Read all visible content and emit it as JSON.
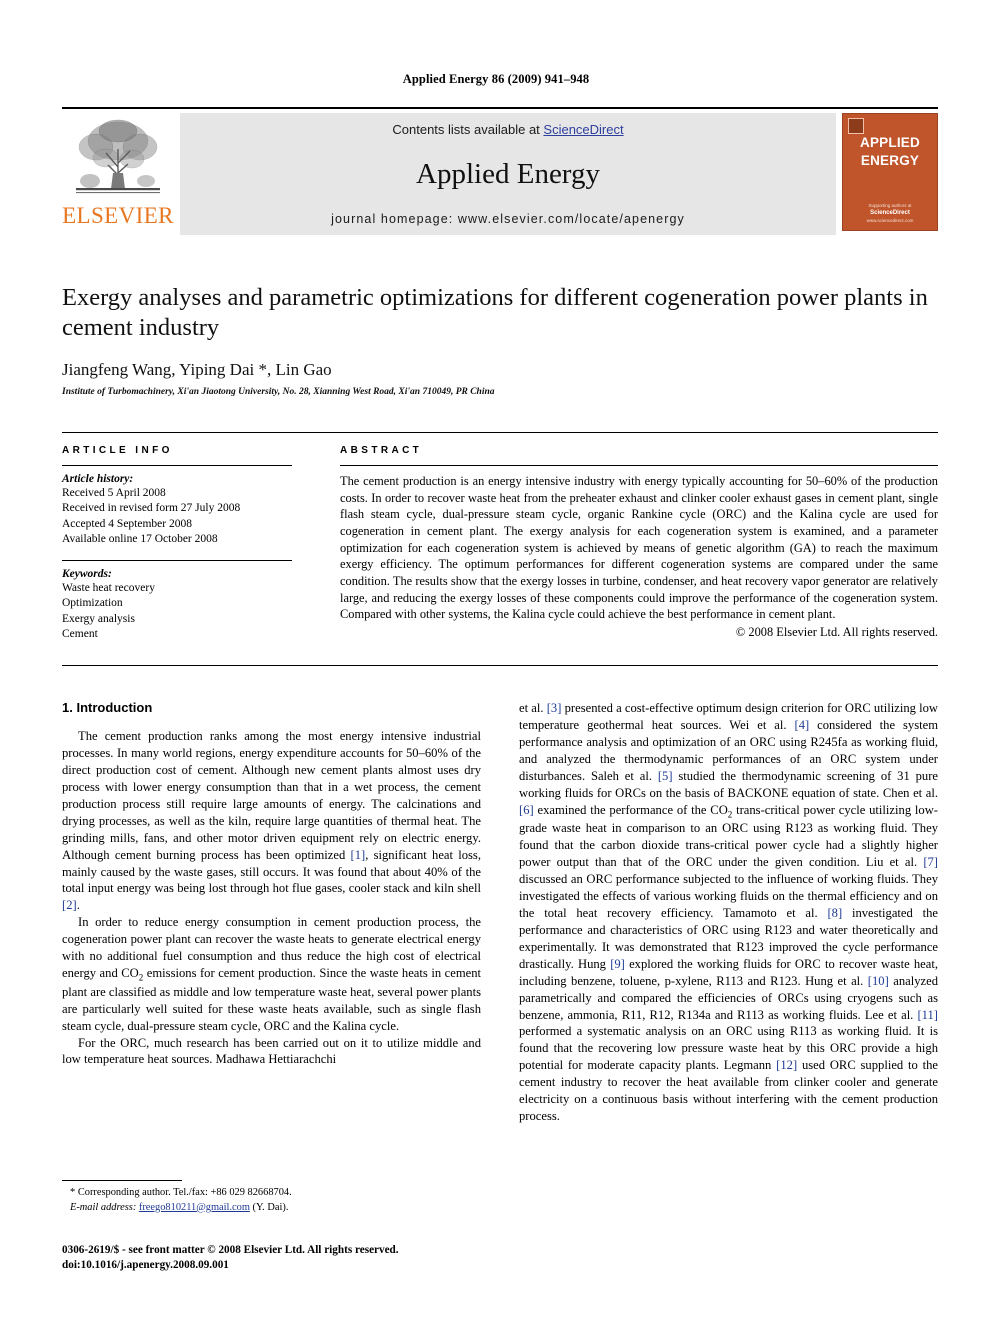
{
  "running_head": "Applied Energy 86 (2009) 941–948",
  "banner": {
    "publisher_name": "ELSEVIER",
    "contents_prefix": "Contents lists available at ",
    "contents_link": "ScienceDirect",
    "journal_name": "Applied Energy",
    "homepage": "journal homepage: www.elsevier.com/locate/apenergy",
    "cover_title_line1": "APPLIED",
    "cover_title_line2": "ENERGY",
    "cover_foot_line1": "Supporting authors at",
    "cover_foot_line2": "ScienceDirect",
    "cover_foot_line3": "www.sciencedirect.com",
    "cover_color": "#C0542A",
    "link_color": "#2C3E9E",
    "elsevier_orange": "#E87722"
  },
  "article": {
    "title": "Exergy analyses and parametric optimizations for different cogeneration power plants in cement industry",
    "authors": "Jiangfeng Wang, Yiping Dai *, Lin Gao",
    "affiliation": "Institute of Turbomachinery, Xi'an Jiaotong University, No. 28, Xianning West Road, Xi'an 710049, PR China"
  },
  "article_info": {
    "label": "ARTICLE INFO",
    "history_head": "Article history:",
    "history": [
      "Received 5 April 2008",
      "Received in revised form 27 July 2008",
      "Accepted 4 September 2008",
      "Available online 17 October 2008"
    ],
    "keywords_head": "Keywords:",
    "keywords": [
      "Waste heat recovery",
      "Optimization",
      "Exergy analysis",
      "Cement"
    ]
  },
  "abstract": {
    "label": "ABSTRACT",
    "text": "The cement production is an energy intensive industry with energy typically accounting for 50–60% of the production costs. In order to recover waste heat from the preheater exhaust and clinker cooler exhaust gases in cement plant, single flash steam cycle, dual-pressure steam cycle, organic Rankine cycle (ORC) and the Kalina cycle are used for cogeneration in cement plant. The exergy analysis for each cogeneration system is examined, and a parameter optimization for each cogeneration system is achieved by means of genetic algorithm (GA) to reach the maximum exergy efficiency. The optimum performances for different cogeneration systems are compared under the same condition. The results show that the exergy losses in turbine, condenser, and heat recovery vapor generator are relatively large, and reducing the exergy losses of these components could improve the performance of the cogeneration system. Compared with other systems, the Kalina cycle could achieve the best performance in cement plant.",
    "copyright": "© 2008 Elsevier Ltd. All rights reserved."
  },
  "introduction": {
    "heading": "1. Introduction",
    "col1_para1_a": "The cement production ranks among the most energy intensive industrial processes. In many world regions, energy expenditure accounts for 50–60% of the direct production cost of cement. Although new cement plants almost uses dry process with lower energy consumption than that in a wet process, the cement production process still require large amounts of energy. The calcinations and drying processes, as well as the kiln, require large quantities of thermal heat. The grinding mills, fans, and other motor driven equipment rely on electric energy. Although cement burning process has been optimized ",
    "col1_ref1": "[1]",
    "col1_para1_b": ", significant heat loss, mainly caused by the waste gases, still occurs. It was found that about 40% of the total input energy was being lost through hot flue gases, cooler stack and kiln shell ",
    "col1_ref2": "[2]",
    "col1_para1_c": ".",
    "col1_para2_a": "In order to reduce energy consumption in cement production process, the cogeneration power plant can recover the waste heats to generate electrical energy with no additional fuel consumption and thus reduce the high cost of electrical energy and CO",
    "col1_para2_sub": "2",
    "col1_para2_b": " emissions for cement production. Since the waste heats in cement plant are classified as middle and low temperature waste heat, several power plants are particularly well suited for these waste heats available, such as single flash steam cycle, dual-pressure steam cycle, ORC and the Kalina cycle.",
    "col1_para3": "For the ORC, much research has been carried out on it to utilize middle and low temperature heat sources. Madhawa Hettiarachchi",
    "col2_seg1": "et al. ",
    "col2_ref3": "[3]",
    "col2_seg2": " presented a cost-effective optimum design criterion for ORC utilizing low temperature geothermal heat sources. Wei et al. ",
    "col2_ref4": "[4]",
    "col2_seg3": " considered the system performance analysis and optimization of an ORC using R245fa as working fluid, and analyzed the thermodynamic performances of an ORC system under disturbances. Saleh et al. ",
    "col2_ref5": "[5]",
    "col2_seg4": " studied the thermodynamic screening of 31 pure working fluids for ORCs on the basis of BACKONE equation of state. Chen et al. ",
    "col2_ref6": "[6]",
    "col2_seg5": " examined the performance of the CO",
    "col2_sub2": "2",
    "col2_seg6": " trans-critical power cycle utilizing low-grade waste heat in comparison to an ORC using R123 as working fluid. They found that the carbon dioxide trans-critical power cycle had a slightly higher power output than that of the ORC under the given condition. Liu et al. ",
    "col2_ref7": "[7]",
    "col2_seg7": " discussed an ORC performance subjected to the influence of working fluids. They investigated the effects of various working fluids on the thermal efficiency and on the total heat recovery efficiency. Tamamoto et al. ",
    "col2_ref8": "[8]",
    "col2_seg8": " investigated the performance and characteristics of ORC using R123 and water theoretically and experimentally. It was demonstrated that R123 improved the cycle performance drastically. Hung ",
    "col2_ref9": "[9]",
    "col2_seg9": " explored the working fluids for ORC to recover waste heat, including benzene, toluene, p-xylene, R113 and R123. Hung et al. ",
    "col2_ref10": "[10]",
    "col2_seg10": " analyzed parametrically and compared the efficiencies of ORCs using cryogens such as benzene, ammonia, R11, R12, R134a and R113 as working fluids. Lee et al. ",
    "col2_ref11": "[11]",
    "col2_seg11": " performed a systematic analysis on an ORC using R113 as working fluid. It is found that the recovering low pressure waste heat by this ORC provide a high potential for moderate capacity plants. Legmann ",
    "col2_ref12": "[12]",
    "col2_seg12": " used ORC supplied to the cement industry to recover the heat available from clinker cooler and generate electricity on a continuous basis without interfering with the cement production process."
  },
  "footnotes": {
    "corresponding_marker": "*",
    "corresponding": "Corresponding author. Tel./fax: +86 029 82668704.",
    "email_label": "E-mail address:",
    "email": "freego810211@gmail.com",
    "email_suffix": "(Y. Dai).",
    "issn_line": "0306-2619/$ - see front matter © 2008 Elsevier Ltd. All rights reserved.",
    "doi_line": "doi:10.1016/j.apenergy.2008.09.001"
  }
}
